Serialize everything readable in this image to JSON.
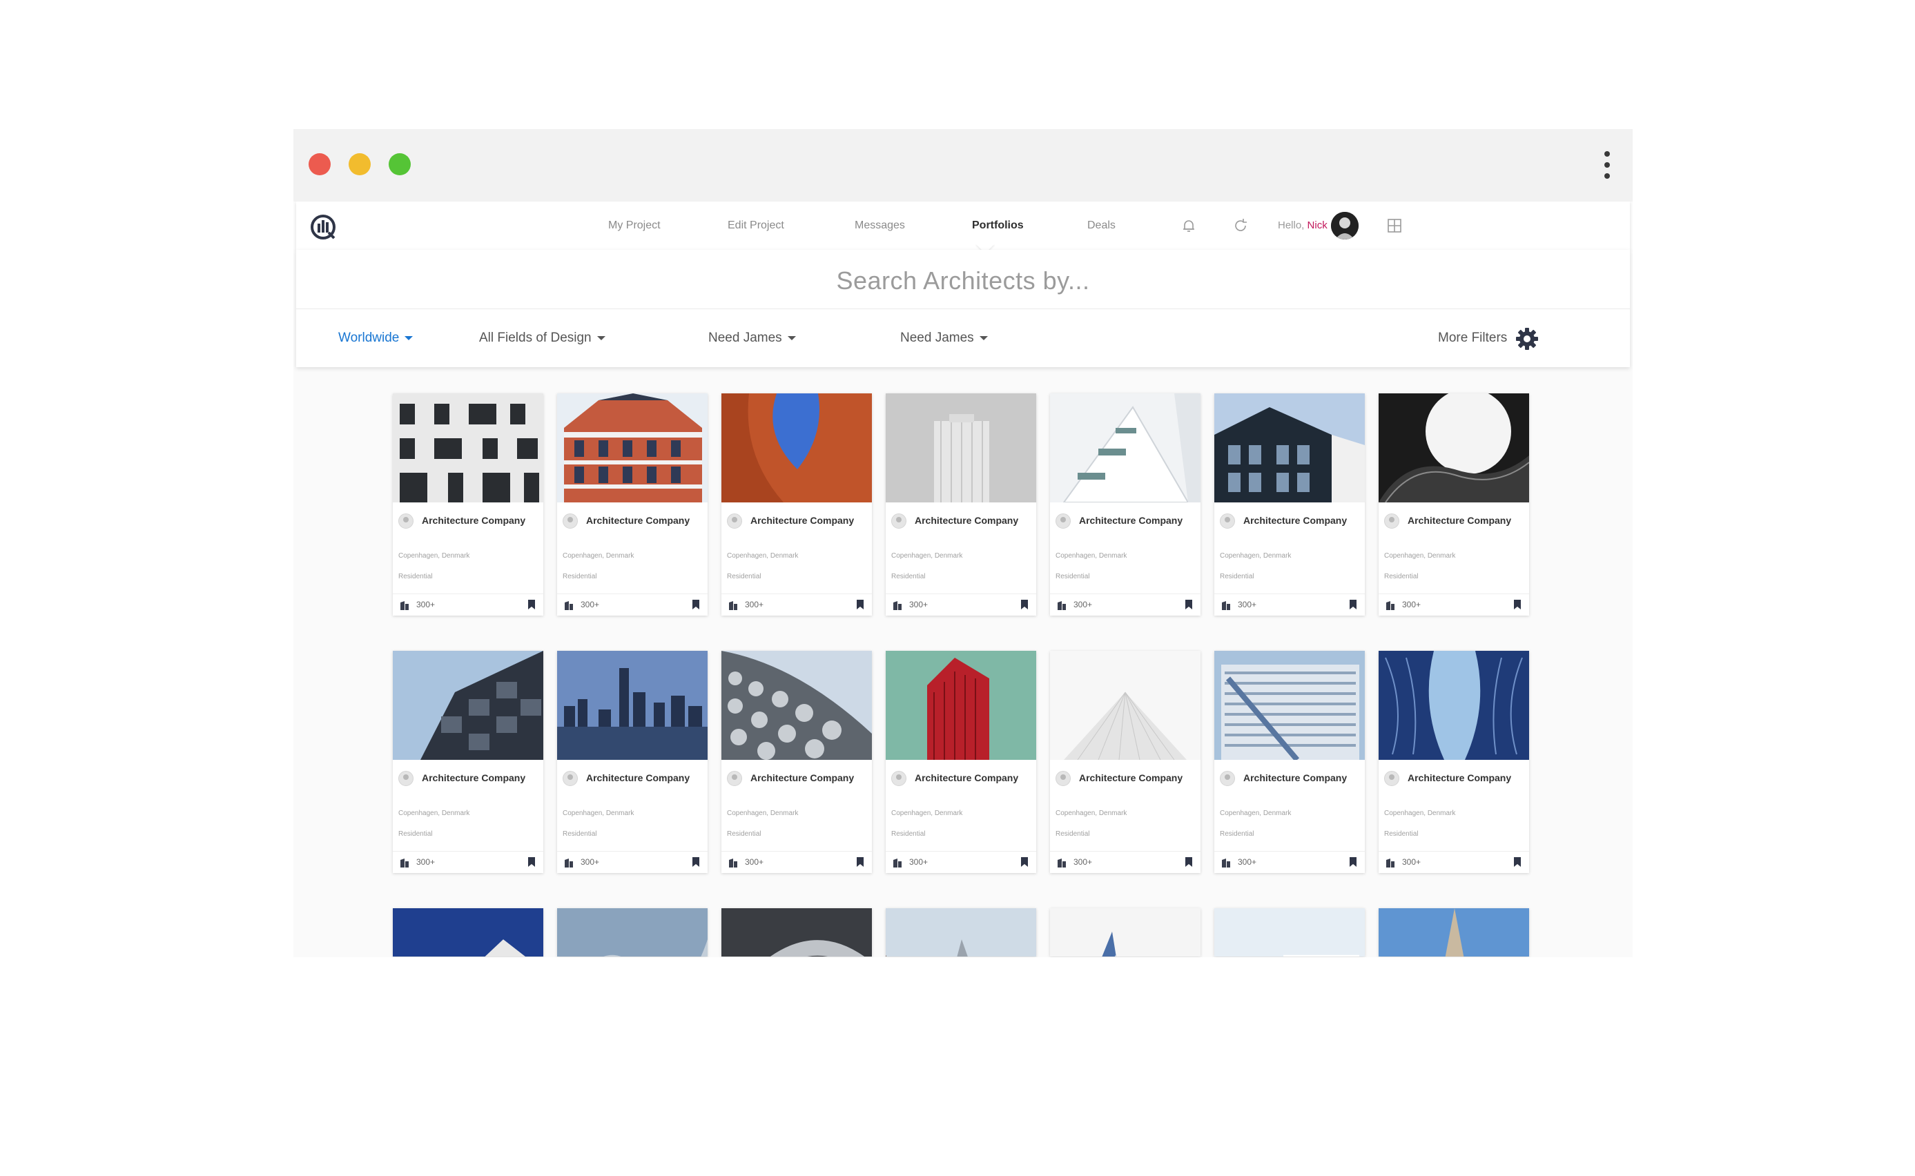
{
  "nav": {
    "items": [
      "My Project",
      "Edit Project",
      "Messages",
      "Portfolios",
      "Deals"
    ],
    "active": "Portfolios",
    "greeting": "Hello,",
    "user_name": "Nick"
  },
  "search": {
    "heading": "Search Architects by..."
  },
  "filters": {
    "location": "Worldwide",
    "field": "All Fields of Design",
    "need1": "Need James",
    "need2": "Need James",
    "more": "More Filters"
  },
  "colors": {
    "accent": "#1976d2",
    "user_name": "#c2185b",
    "close": "#ec5b4f",
    "minimize": "#f2bc2e",
    "maximize": "#55c436"
  },
  "cards": [
    {
      "title": "Architecture Company",
      "location": "Copenhagen, Denmark",
      "type": "Residential",
      "count": "300+"
    },
    {
      "title": "Architecture Company",
      "location": "Copenhagen, Denmark",
      "type": "Residential",
      "count": "300+"
    },
    {
      "title": "Architecture Company",
      "location": "Copenhagen, Denmark",
      "type": "Residential",
      "count": "300+"
    },
    {
      "title": "Architecture Company",
      "location": "Copenhagen, Denmark",
      "type": "Residential",
      "count": "300+"
    },
    {
      "title": "Architecture Company",
      "location": "Copenhagen, Denmark",
      "type": "Residential",
      "count": "300+"
    },
    {
      "title": "Architecture Company",
      "location": "Copenhagen, Denmark",
      "type": "Residential",
      "count": "300+"
    },
    {
      "title": "Architecture Company",
      "location": "Copenhagen, Denmark",
      "type": "Residential",
      "count": "300+"
    },
    {
      "title": "Architecture Company",
      "location": "Copenhagen, Denmark",
      "type": "Residential",
      "count": "300+"
    },
    {
      "title": "Architecture Company",
      "location": "Copenhagen, Denmark",
      "type": "Residential",
      "count": "300+"
    },
    {
      "title": "Architecture Company",
      "location": "Copenhagen, Denmark",
      "type": "Residential",
      "count": "300+"
    },
    {
      "title": "Architecture Company",
      "location": "Copenhagen, Denmark",
      "type": "Residential",
      "count": "300+"
    },
    {
      "title": "Architecture Company",
      "location": "Copenhagen, Denmark",
      "type": "Residential",
      "count": "300+"
    },
    {
      "title": "Architecture Company",
      "location": "Copenhagen, Denmark",
      "type": "Residential",
      "count": "300+"
    },
    {
      "title": "Architecture Company",
      "location": "Copenhagen, Denmark",
      "type": "Residential",
      "count": "300+"
    }
  ],
  "icons": [
    "app-logo-icon",
    "bell-icon",
    "refresh-icon",
    "grid-icon",
    "gear-icon",
    "building-icon",
    "bookmark-icon",
    "kebab-menu-icon"
  ]
}
